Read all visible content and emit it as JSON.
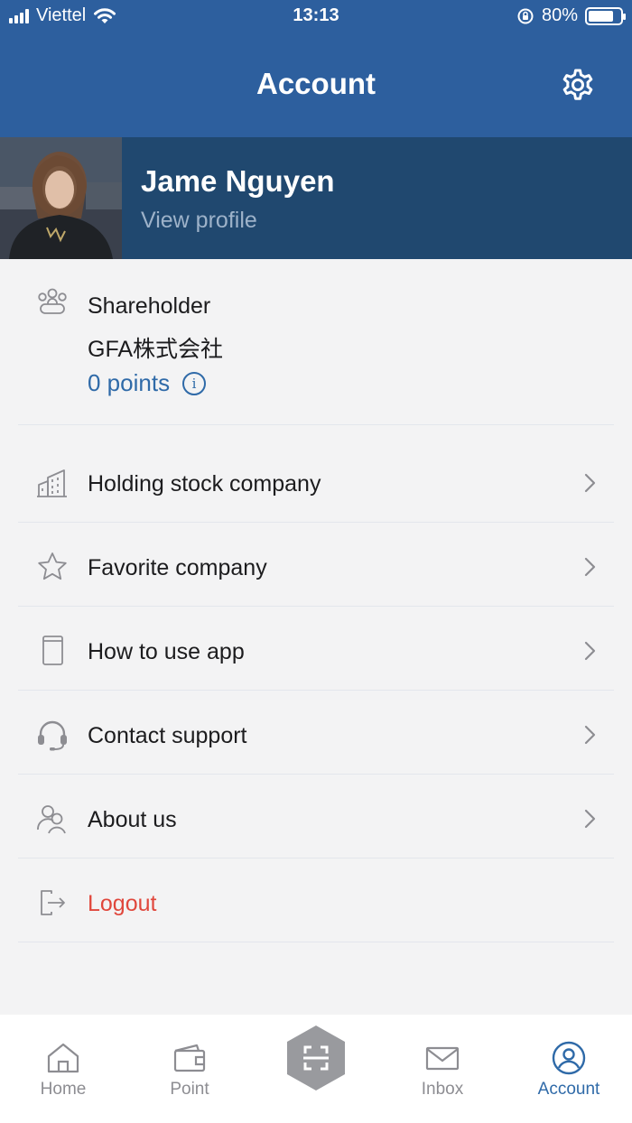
{
  "status_bar": {
    "carrier": "Viettel",
    "time": "13:13",
    "battery": "80%",
    "battery_level": 0.8
  },
  "header": {
    "title": "Account",
    "settings_icon": "gear-icon"
  },
  "profile": {
    "name": "Jame Nguyen",
    "link": "View profile"
  },
  "info": {
    "role": "Shareholder",
    "company": "GFA株式会社",
    "points": "0 points",
    "info_glyph": "i"
  },
  "menu": {
    "items": [
      {
        "label": "Holding stock company",
        "icon": "building-icon"
      },
      {
        "label": "Favorite company",
        "icon": "star-icon"
      },
      {
        "label": "How to use app",
        "icon": "book-icon"
      },
      {
        "label": "Contact support",
        "icon": "headset-icon"
      },
      {
        "label": "About us",
        "icon": "users-icon"
      },
      {
        "label": "Logout",
        "icon": "logout-icon"
      }
    ]
  },
  "tabbar": {
    "tabs": [
      {
        "label": "Home",
        "icon": "home-icon"
      },
      {
        "label": "Point",
        "icon": "wallet-icon"
      },
      {
        "label": "",
        "icon": "scan-icon"
      },
      {
        "label": "Inbox",
        "icon": "mail-icon"
      },
      {
        "label": "Account",
        "icon": "user-circle-icon"
      }
    ],
    "active": "Account"
  },
  "colors": {
    "header_bg": "#2d5f9e",
    "profile_bg": "#20486f",
    "accent": "#2f6aa8",
    "logout": "#e0473c",
    "background": "#f3f3f4"
  }
}
